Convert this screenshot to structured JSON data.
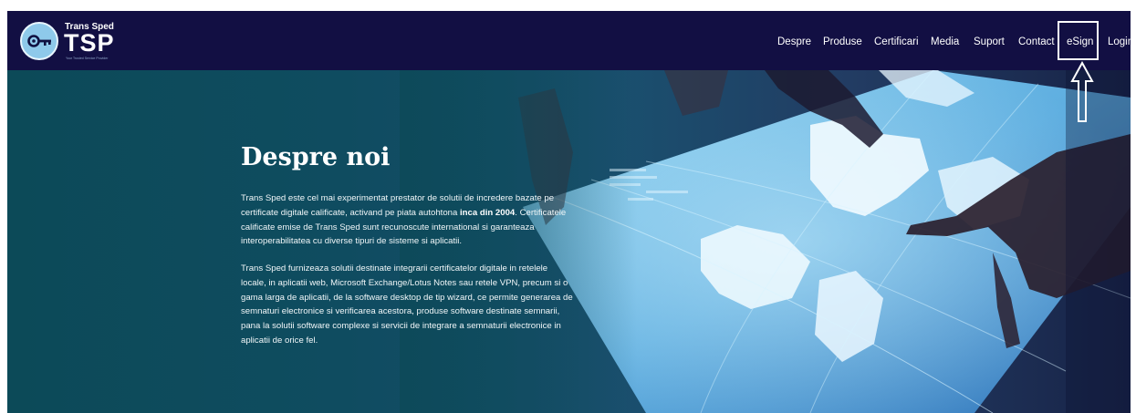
{
  "brand": {
    "company": "Trans Sped",
    "name": "TSP",
    "tagline": "Your Trusted Service Provider"
  },
  "nav": {
    "items": [
      {
        "id": "despre",
        "label": "Despre"
      },
      {
        "id": "produse",
        "label": "Produse"
      },
      {
        "id": "certificari",
        "label": "Certificari"
      },
      {
        "id": "media",
        "label": "Media"
      },
      {
        "id": "suport",
        "label": "Suport"
      },
      {
        "id": "contact",
        "label": "Contact"
      },
      {
        "id": "esign",
        "label": "eSign",
        "highlighted": true
      },
      {
        "id": "login",
        "label": "Login"
      }
    ]
  },
  "hero": {
    "title": "Despre noi",
    "paragraph1": {
      "before": "Trans Sped este cel mai experimentat prestator de solutii de incredere bazate pe certificate digitale calificate, activand pe piata autohtona ",
      "bold": "inca din 2004",
      "after": ". Certificatele calificate emise de Trans Sped sunt recunoscute international si garanteaza interoperabilitatea cu diverse tipuri de sisteme si aplicatii."
    },
    "paragraph2": "Trans Sped furnizeaza solutii destinate integrarii certificatelor digitale in retelele locale, in aplicatii web, Microsoft Exchange/Lotus Notes sau retele VPN, precum si o gama larga de aplicatii, de la software desktop de tip wizard, ce permite generarea de semnaturi electronice si verificarea acestora, produse software destinate semnarii, pana la solutii software complexe si servicii de integrare a semnaturii electronice in aplicatii de orice fel."
  },
  "icons": {
    "logo": "key-icon",
    "annotation": "up-arrow-icon"
  },
  "colors": {
    "navbar": "#120f43",
    "hero_left": "#0c4a58",
    "hero_right": "#182347",
    "text": "#ffffff",
    "highlight_box": "#ffffff"
  }
}
